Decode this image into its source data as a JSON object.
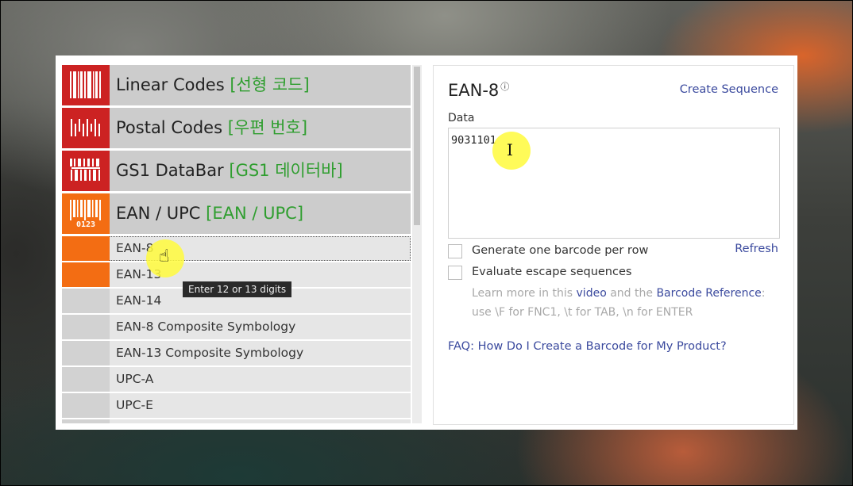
{
  "categories": [
    {
      "name": "Linear Codes",
      "ko": "[선형 코드]",
      "icon": "linear-barcode-icon"
    },
    {
      "name": "Postal Codes",
      "ko": "[우편 번호]",
      "icon": "postal-barcode-icon"
    },
    {
      "name": "GS1 DataBar",
      "ko": "[GS1 데이터바]",
      "icon": "gs1-databar-icon"
    },
    {
      "name": "EAN / UPC",
      "ko": "[EAN / UPC]",
      "icon": "ean-upc-icon"
    }
  ],
  "ean_icon_digits": "0123",
  "subitems": [
    {
      "label": "EAN-8"
    },
    {
      "label": "EAN-13"
    },
    {
      "label": "EAN-14"
    },
    {
      "label": "EAN-8 Composite Symbology"
    },
    {
      "label": "EAN-13 Composite Symbology"
    },
    {
      "label": "UPC-A"
    },
    {
      "label": "UPC-E"
    }
  ],
  "tooltip": "Enter 12 or 13 digits",
  "panel": {
    "title": "EAN-8",
    "info_symbol": "ⓘ",
    "create_sequence": "Create Sequence",
    "data_label": "Data",
    "data_value": "9031101",
    "generate_per_row": "Generate one barcode per row",
    "refresh": "Refresh",
    "evaluate_escape": "Evaluate escape sequences",
    "help_1": "Learn more in this",
    "help_video": "video",
    "help_2": "and the",
    "help_ref": "Barcode Reference",
    "help_3": ": use \\F for FNC1, \\t for TAB, \\n for ENTER",
    "faq": "FAQ: How Do I Create a Barcode for My Product?"
  },
  "colors": {
    "category_red": "#cc2222",
    "category_orange": "#f36d13",
    "korean_green": "#2f9e2f",
    "link_blue": "#3b4a9e"
  }
}
